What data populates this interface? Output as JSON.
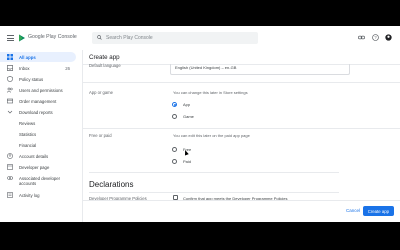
{
  "header": {
    "brand": "Google Play Console",
    "search_placeholder": "Search Play Console"
  },
  "sidebar": {
    "items": [
      {
        "label": "All apps",
        "count": ""
      },
      {
        "label": "Inbox",
        "count": "26"
      },
      {
        "label": "Policy status",
        "count": ""
      },
      {
        "label": "Users and permissions",
        "count": ""
      },
      {
        "label": "Order management",
        "count": ""
      },
      {
        "label": "Download reports",
        "count": ""
      },
      {
        "label": "Reviews",
        "count": ""
      },
      {
        "label": "Statistics",
        "count": ""
      },
      {
        "label": "Financial",
        "count": ""
      },
      {
        "label": "Account details",
        "count": ""
      },
      {
        "label": "Developer page",
        "count": ""
      },
      {
        "label": "Associated developer accounts",
        "count": ""
      },
      {
        "label": "Activity log",
        "count": ""
      }
    ]
  },
  "main": {
    "title": "Create app",
    "default_language_label": "Default language",
    "default_language_value": "English (United Kingdom) – en-GB",
    "app_or_game_label": "App or game",
    "app_or_game_help": "You can change this later in Store settings",
    "app_option": "App",
    "game_option": "Game",
    "free_or_paid_label": "Free or paid",
    "free_or_paid_help": "You can edit this later on the paid app page",
    "free_option": "Free",
    "paid_option": "Paid",
    "declarations_title": "Declarations",
    "policies_label": "Developer Programme Policies",
    "policies_checkbox_label": "Confirm that app meets the Developer Programme Policies"
  },
  "footer": {
    "cancel_label": "Cancel",
    "create_label": "Create app"
  },
  "colors": {
    "accent": "#1a73e8",
    "active_bg": "#e8f0fe"
  }
}
